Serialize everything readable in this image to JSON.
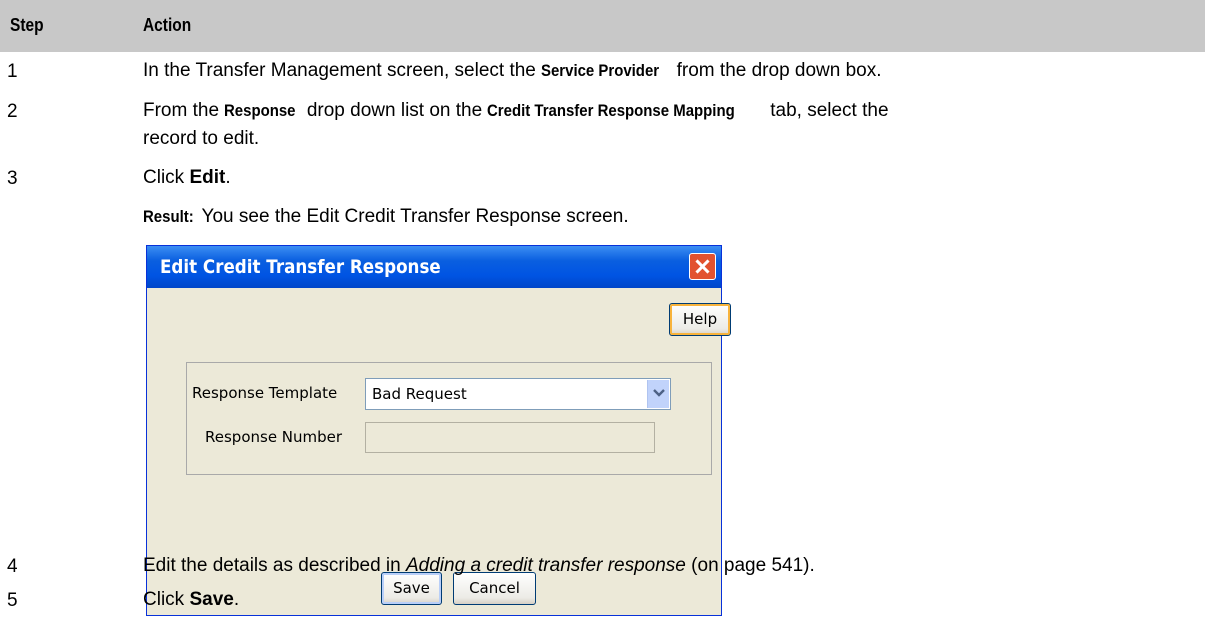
{
  "table": {
    "header_step": "Step",
    "header_action": "Action"
  },
  "steps": [
    {
      "num": "1",
      "pre": "In the Transfer Management screen, select the ",
      "b1": "Service Provider",
      "post": " from the drop down box."
    },
    {
      "num": "2",
      "pre": "From the ",
      "b1": "Response",
      "mid": " drop down list on the ",
      "b2": "Credit Transfer Response Mapping",
      "post": " tab, select the",
      "line2": "record to edit."
    },
    {
      "num": "3",
      "pre": "Click ",
      "b1": "Edit",
      "post": ".",
      "result_label": "Result:",
      "result_text": " You see the Edit Credit Transfer Response screen."
    },
    {
      "num": "4",
      "pre": "Edit the details as described in ",
      "link": "Adding a credit transfer response",
      "post": " (on page 541)."
    },
    {
      "num": "5",
      "pre": "Click ",
      "b1": "Save",
      "post": "."
    }
  ],
  "dialog": {
    "title": "Edit Credit Transfer Response",
    "help_label": "Help",
    "response_template_label": "Response Template",
    "response_template_value": "Bad Request",
    "response_number_label": "Response Number",
    "response_number_value": "",
    "save_label": "Save",
    "cancel_label": "Cancel"
  },
  "colors": {
    "header_bg": "#c8c8c8",
    "titlebar": "#0054e3",
    "dialog_bg": "#ece9d8",
    "close_button": "#e2522f"
  }
}
